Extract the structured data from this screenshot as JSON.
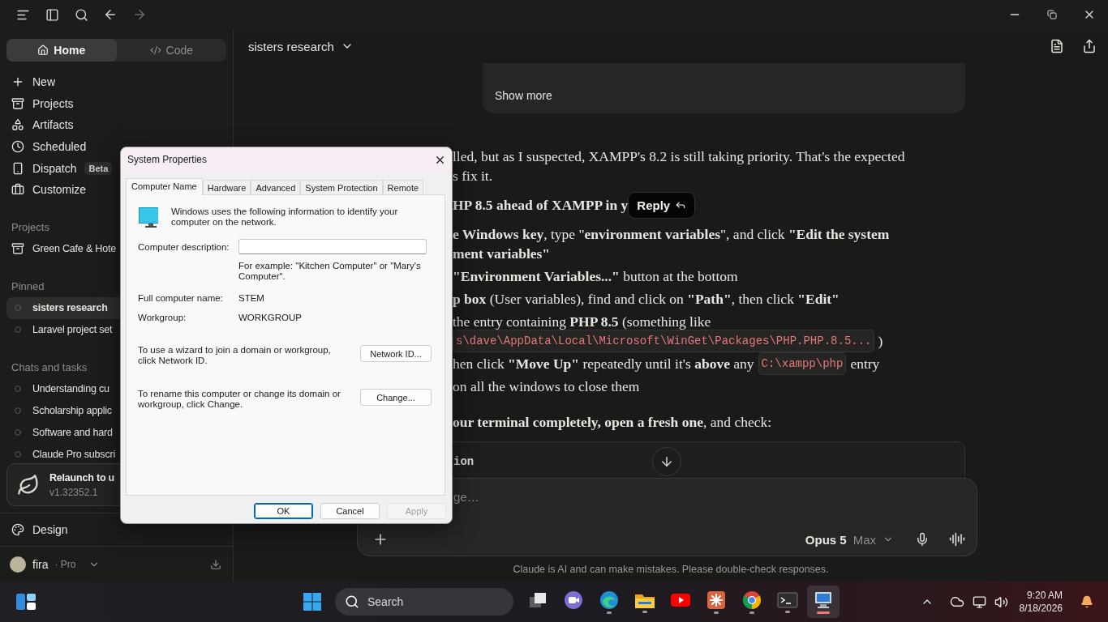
{
  "toolbar": {
    "back_disabled": false,
    "forward_disabled": true
  },
  "sidebar": {
    "mode_tabs": [
      {
        "label": "Home",
        "selected": true
      },
      {
        "label": "Code",
        "selected": false
      }
    ],
    "nav": [
      {
        "label": "New"
      },
      {
        "label": "Projects"
      },
      {
        "label": "Artifacts"
      },
      {
        "label": "Scheduled"
      },
      {
        "label": "Dispatch",
        "badge": "Beta"
      },
      {
        "label": "Customize"
      }
    ],
    "sections": [
      {
        "title": "Projects",
        "items": [
          {
            "label": "Green Cafe & Hote",
            "kind": "project",
            "selected": false
          }
        ]
      },
      {
        "title": "Pinned",
        "items": [
          {
            "label": "sisters research",
            "kind": "chat",
            "selected": true
          },
          {
            "label": "Laravel project set",
            "kind": "chat",
            "selected": false
          }
        ]
      },
      {
        "title": "Chats and tasks",
        "items": [
          {
            "label": "Understanding cu",
            "kind": "chat",
            "selected": false
          },
          {
            "label": "Scholarship applic",
            "kind": "chat",
            "selected": false
          },
          {
            "label": "Software and hard",
            "kind": "chat",
            "selected": false
          },
          {
            "label": "Claude Pro subscri",
            "kind": "chat",
            "selected": false
          }
        ]
      }
    ],
    "update_card": {
      "title": "Relaunch to u",
      "version": "v1.32352.1"
    },
    "design": {
      "label": "Design"
    },
    "account": {
      "name": "fira",
      "plan": "· Pro"
    }
  },
  "main": {
    "header": {
      "title": "sisters research"
    },
    "card": {
      "action": "Show more"
    },
    "message": [
      {
        "kind": "paragraph",
        "items": [
          {
            "lines": [
              [
                {
                  "kind": "text",
                  "text": "lled, but as I suspected, XAMPP's 8.2 is still taking priority. That's the expected"
                }
              ],
              [
                {
                  "kind": "text",
                  "text": "s fix it."
                }
              ]
            ]
          }
        ]
      },
      {
        "kind": "heading",
        "items": [
          {
            "lines": [
              [
                {
                  "kind": "text",
                  "text": "HP 8.5 ahead of XAMPP in y"
                },
                {
                  "kind": "reply",
                  "text": "Reply"
                }
              ]
            ]
          }
        ]
      },
      {
        "kind": "list",
        "items": [
          {
            "lines": [
              [
                {
                  "kind": "text",
                  "text": "**e Windows key**, type \"**environment variables**\", and click **\"Edit the system**"
                }
              ],
              [
                {
                  "kind": "text",
                  "text": "**ment variables\"**"
                }
              ]
            ]
          },
          {
            "lines": [
              [
                {
                  "kind": "text",
                  "text": "**\"Environment Variables...\"** button at the bottom"
                }
              ]
            ]
          },
          {
            "lines": [
              [
                {
                  "kind": "text",
                  "text": "**p box** (User variables), find and click on **\"Path\"**, then click **\"Edit\"**"
                }
              ]
            ]
          },
          {
            "lines": [
              [
                {
                  "kind": "text",
                  "text": "the entry containing **PHP 8.5** (something like"
                }
              ],
              [
                {
                  "kind": "code",
                  "text": "s\\dave\\AppData\\Local\\Microsoft\\WinGet\\Packages\\PHP.PHP.8.5..."
                },
                {
                  "kind": "text",
                  "text": ")"
                }
              ]
            ]
          },
          {
            "lines": [
              [
                {
                  "kind": "text",
                  "text": "hen click **\"Move Up\"** repeatedly until it's **above** any"
                },
                {
                  "kind": "code",
                  "text": "C:\\xampp\\php"
                },
                {
                  "kind": "text",
                  "text": "entry"
                }
              ]
            ]
          },
          {
            "lines": [
              [
                {
                  "kind": "text",
                  "text": "on all the windows to close them"
                }
              ]
            ]
          }
        ]
      },
      {
        "kind": "paragraph",
        "items": [
          {
            "lines": [
              [
                {
                  "kind": "text",
                  "text": "**our terminal completely, open a fresh one**, and check:"
                }
              ]
            ]
          }
        ]
      }
    ],
    "code_block": {
      "text": "ion"
    },
    "composer": {
      "placeholder": "ge…",
      "model": "Opus 5",
      "effort": "Max"
    },
    "disclaimer": "Claude is AI and can make mistakes. Please double-check responses."
  },
  "dialog": {
    "title": "System Properties",
    "tabs": [
      {
        "label": "Computer Name",
        "selected": true
      },
      {
        "label": "Hardware",
        "selected": false
      },
      {
        "label": "Advanced",
        "selected": false
      },
      {
        "label": "System Protection",
        "selected": false
      },
      {
        "label": "Remote",
        "selected": false
      }
    ],
    "intro": "Windows uses the following information to identify your computer on the network.",
    "description_label": "Computer description:",
    "example": "For example: \"Kitchen Computer\" or \"Mary's Computer\".",
    "full_name_label": "Full computer name:",
    "full_name": "STEM",
    "workgroup_label": "Workgroup:",
    "workgroup": "WORKGROUP",
    "wizard_text": "To use a wizard to join a domain or workgroup, click Network ID.",
    "wizard_button": "Network ID...",
    "rename_text": "To rename this computer or change its domain or workgroup, click Change.",
    "rename_button": "Change...",
    "buttons": [
      {
        "label": "OK",
        "default": true,
        "disabled": false
      },
      {
        "label": "Cancel",
        "default": false,
        "disabled": false
      },
      {
        "label": "Apply",
        "default": false,
        "disabled": true
      }
    ]
  },
  "taskbar": {
    "search_placeholder": "Search",
    "apps": [
      {
        "kind": "taskview",
        "running": false,
        "selected": false
      },
      {
        "kind": "meet",
        "running": false,
        "selected": false
      },
      {
        "kind": "edge",
        "running": true,
        "selected": false
      },
      {
        "kind": "files",
        "running": true,
        "selected": false
      },
      {
        "kind": "video",
        "running": false,
        "selected": false
      },
      {
        "kind": "claude",
        "running": true,
        "selected": false
      },
      {
        "kind": "chrome",
        "running": true,
        "selected": false
      },
      {
        "kind": "terminal",
        "running": true,
        "selected": false
      },
      {
        "kind": "system",
        "running": true,
        "selected": true
      }
    ],
    "clock": {
      "time": "9:20 AM",
      "date": "8/18/2026"
    }
  }
}
